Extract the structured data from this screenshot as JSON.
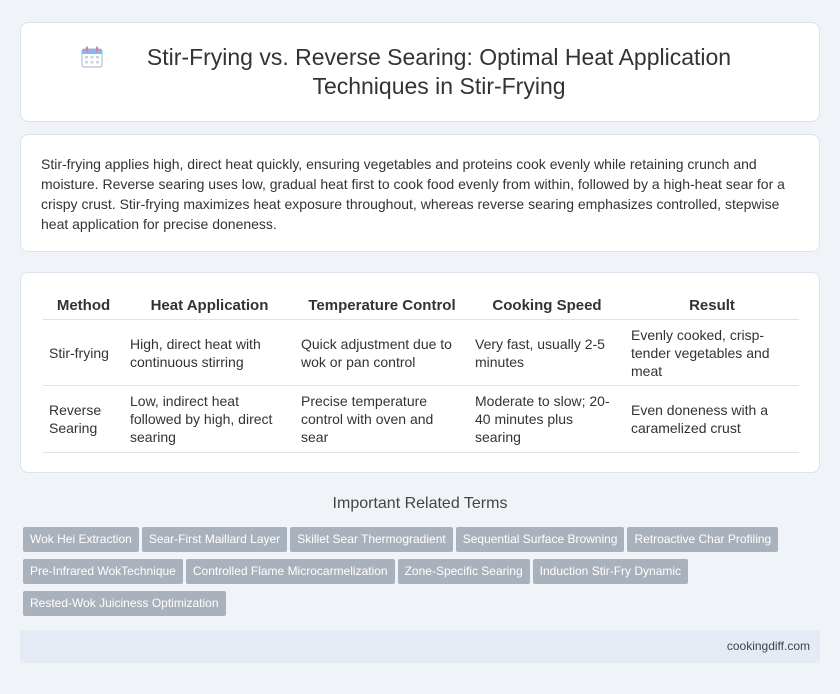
{
  "header": {
    "title": "Stir-Frying vs. Reverse Searing: Optimal Heat Application Techniques in Stir-Frying"
  },
  "intro": {
    "text": "Stir-frying applies high, direct heat quickly, ensuring vegetables and proteins cook evenly while retaining crunch and moisture. Reverse searing uses low, gradual heat first to cook food evenly from within, followed by a high-heat sear for a crispy crust. Stir-frying maximizes heat exposure throughout, whereas reverse searing emphasizes controlled, stepwise heat application for precise doneness."
  },
  "table": {
    "headers": [
      "Method",
      "Heat Application",
      "Temperature Control",
      "Cooking Speed",
      "Result"
    ],
    "rows": [
      [
        "Stir-frying",
        "High, direct heat with continuous stirring",
        "Quick adjustment due to wok or pan control",
        "Very fast, usually 2-5 minutes",
        "Evenly cooked, crisp-tender vegetables and meat"
      ],
      [
        "Reverse Searing",
        "Low, indirect heat followed by high, direct searing",
        "Precise temperature control with oven and sear",
        "Moderate to slow; 20-40 minutes plus searing",
        "Even doneness with a caramelized crust"
      ]
    ]
  },
  "related": {
    "heading": "Important Related Terms",
    "tags": [
      "Wok Hei Extraction",
      "Sear-First Maillard Layer",
      "Skillet Sear Thermogradient",
      "Sequential Surface Browning",
      "Retroactive Char Profiling",
      "Pre-Infrared WokTechnique",
      "Controlled Flame Microcarmelization",
      "Zone-Specific Searing",
      "Induction Stir-Fry Dynamic",
      "Rested-Wok Juiciness Optimization"
    ]
  },
  "footer": {
    "site": "cookingdiff.com"
  },
  "icons": {
    "title_icon": "calendar-icon"
  },
  "colors": {
    "background": "#f0f3f8",
    "tag_bg": "#a9b1bd",
    "footer_bg": "#e5ebf4",
    "icon_accent": "#8ab4f0"
  }
}
